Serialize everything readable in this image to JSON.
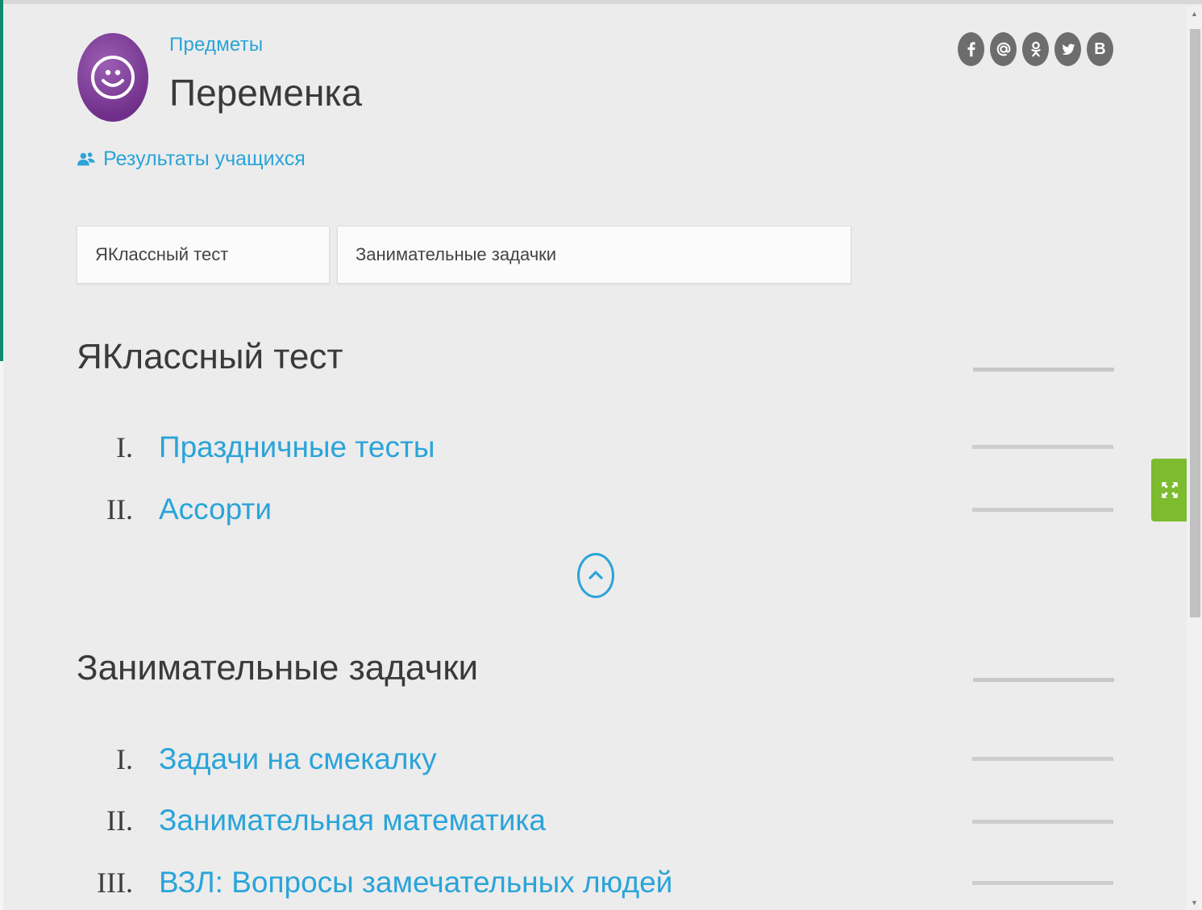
{
  "header": {
    "breadcrumb": "Предметы",
    "title": "Переменка",
    "results_link": "Результаты учащихся"
  },
  "social": [
    {
      "name": "facebook-icon",
      "glyph": "f"
    },
    {
      "name": "mail-icon",
      "glyph": "@"
    },
    {
      "name": "odnoklassniki-icon",
      "glyph": "ok"
    },
    {
      "name": "twitter-icon",
      "glyph": "bird"
    },
    {
      "name": "vkontakte-icon",
      "glyph": "B"
    }
  ],
  "tabs": [
    {
      "label": "ЯКлассный тест"
    },
    {
      "label": "Занимательные задачки"
    }
  ],
  "sections": [
    {
      "title": "ЯКлассный тест",
      "items": [
        {
          "num": "I.",
          "label": "Праздничные тесты"
        },
        {
          "num": "II.",
          "label": "Ассорти"
        }
      ]
    },
    {
      "title": "Занимательные задачки",
      "items": [
        {
          "num": "I.",
          "label": "Задачи на смекалку"
        },
        {
          "num": "II.",
          "label": "Занимательная математика"
        },
        {
          "num": "III.",
          "label": "ВЗЛ: Вопросы замечательных людей"
        }
      ]
    }
  ],
  "colors": {
    "accent": "#2aa4d9",
    "logo": "#7b3a96",
    "fullscreen": "#7dbb2f",
    "background": "#ececec"
  },
  "icons": {
    "logo": "smiley-icon",
    "results": "users-icon",
    "scroll_top": "chevron-up-circle-icon",
    "fullscreen": "expand-icon"
  }
}
